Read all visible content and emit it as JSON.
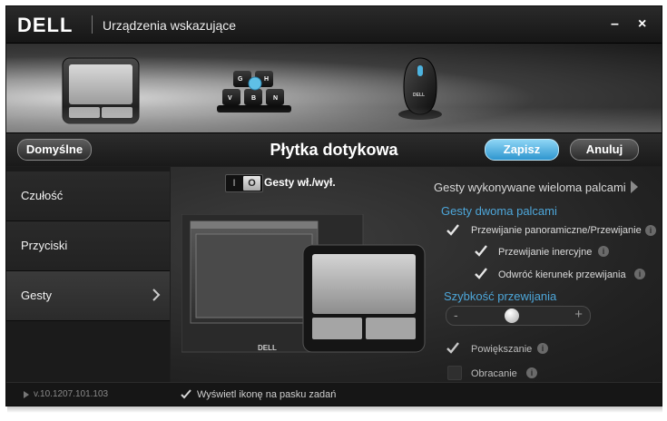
{
  "window": {
    "logo": "DELL",
    "title": "Urządzenia wskazujące",
    "minimize_label": "–",
    "close_label": "×"
  },
  "banner": {
    "devices": [
      {
        "name": "touchpad",
        "selected": true
      },
      {
        "name": "keyboard-gestures",
        "keys": [
          "G",
          "H",
          "V",
          "B",
          "N"
        ]
      },
      {
        "name": "mouse",
        "brand": "DELL"
      }
    ]
  },
  "toolbar": {
    "defaults_label": "Domyślne",
    "page_title": "Płytka dotykowa",
    "save_label": "Zapisz",
    "cancel_label": "Anuluj"
  },
  "sidebar": {
    "items": [
      {
        "label": "Czułość"
      },
      {
        "label": "Przyciski"
      },
      {
        "label": "Gesty",
        "active": true
      }
    ]
  },
  "main": {
    "toggle": {
      "off_label": "I",
      "on_label": "O",
      "label": "Gesty wł./wył.",
      "on": true
    },
    "preview_brand": "DELL",
    "multi_finger_label": "Gesty wykonywane wieloma palcami",
    "two_finger_heading": "Gesty dwoma palcami",
    "options": {
      "pan_scroll": {
        "label": "Przewijanie panoramiczne/Przewijanie",
        "checked": true
      },
      "inertial": {
        "label": "Przewijanie inercyjne",
        "checked": true
      },
      "reverse": {
        "label": "Odwróć kierunek przewijania",
        "checked": true
      }
    },
    "speed_heading": "Szybkość przewijania",
    "speed": {
      "minus": "-",
      "plus": "+",
      "value": 0.45
    },
    "zoom": {
      "label": "Powiększanie",
      "checked": true
    },
    "rotate": {
      "label": "Obracanie",
      "checked": false
    }
  },
  "footer": {
    "version": "v.10.1207.101.103",
    "tray_icon_label": "Wyświetl ikonę na pasku zadań",
    "tray_icon_checked": true
  },
  "colors": {
    "accent_blue": "#4da6d9",
    "save_button": "#2f96cf"
  }
}
